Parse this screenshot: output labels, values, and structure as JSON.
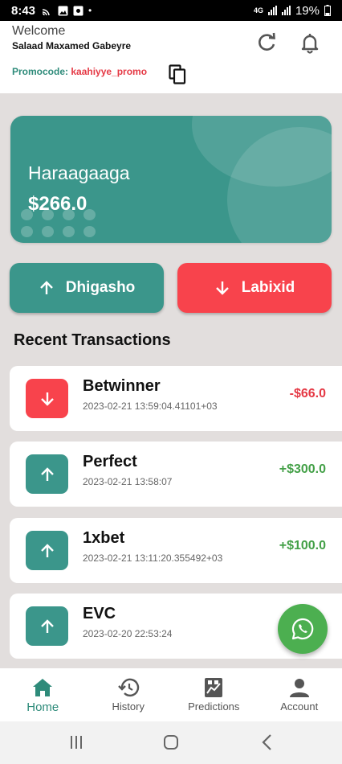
{
  "status_bar": {
    "time": "8:43",
    "network": "4G",
    "battery": "19%"
  },
  "header": {
    "welcome": "Welcome",
    "username": "Salaad Maxamed Gabeyre",
    "promo_label": "Promocode: ",
    "promo_code": "kaahiyye_promo"
  },
  "balance": {
    "label": "Haraagaaga",
    "amount": "$266.0"
  },
  "actions": {
    "deposit_label": "Dhigasho",
    "withdraw_label": "Labixid"
  },
  "transactions_title": "Recent Transactions",
  "transactions": [
    {
      "name": "Betwinner",
      "date": "2023-02-21 13:59:04.41101+03",
      "amount": "-$66.0",
      "direction": "out"
    },
    {
      "name": "Perfect",
      "date": "2023-02-21 13:58:07",
      "amount": "+$300.0",
      "direction": "in"
    },
    {
      "name": "1xbet",
      "date": "2023-02-21 13:11:20.355492+03",
      "amount": "+$100.0",
      "direction": "in"
    },
    {
      "name": "EVC",
      "date": "2023-02-20 22:53:24",
      "amount": "",
      "direction": "in"
    }
  ],
  "nav": [
    {
      "label": "Home",
      "icon": "home-icon",
      "active": true
    },
    {
      "label": "History",
      "icon": "history-icon",
      "active": false
    },
    {
      "label": "Predictions",
      "icon": "predictions-icon",
      "active": false
    },
    {
      "label": "Account",
      "icon": "account-icon",
      "active": false
    }
  ],
  "colors": {
    "primary": "#3b968b",
    "danger": "#f8434c",
    "success": "#43a047",
    "fab": "#4caf50"
  }
}
